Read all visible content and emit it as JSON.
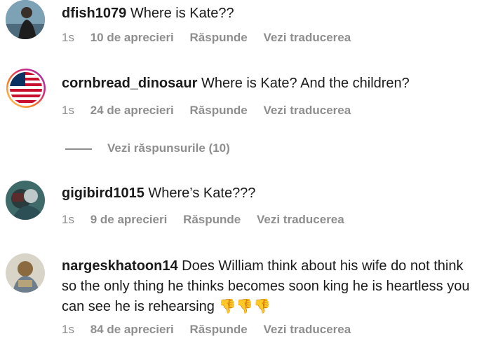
{
  "comments": [
    {
      "username": "dfish1079",
      "text": "Where is Kate??",
      "time": "1s",
      "likes": "10 de aprecieri",
      "reply": "Răspunde",
      "translate": "Vezi traducerea"
    },
    {
      "username": "cornbread_dinosaur",
      "text": "Where is Kate? And the children?",
      "time": "1s",
      "likes": "24 de aprecieri",
      "reply": "Răspunde",
      "translate": "Vezi traducerea"
    },
    {
      "username": "gigibird1015",
      "text": "Where’s Kate???",
      "time": "1s",
      "likes": "9 de aprecieri",
      "reply": "Răspunde",
      "translate": "Vezi traducerea"
    },
    {
      "username": "nargeskhatoon14",
      "text": "Does William think about his wife do not think so the only thing he thinks becomes soon king he is heartless you can see he is rehearsing",
      "emoji": "👎👎👎",
      "time": "1s",
      "likes": "84 de aprecieri",
      "reply": "Răspunde",
      "translate": "Vezi traducerea"
    }
  ],
  "view_replies": "Vezi răspunsurile (10)",
  "colors": {
    "text": "#1a1a1a",
    "meta": "#8e8e8e",
    "story_ring_gradient": [
      "#feda75",
      "#fa7e1e",
      "#d62976",
      "#962fbf"
    ]
  }
}
